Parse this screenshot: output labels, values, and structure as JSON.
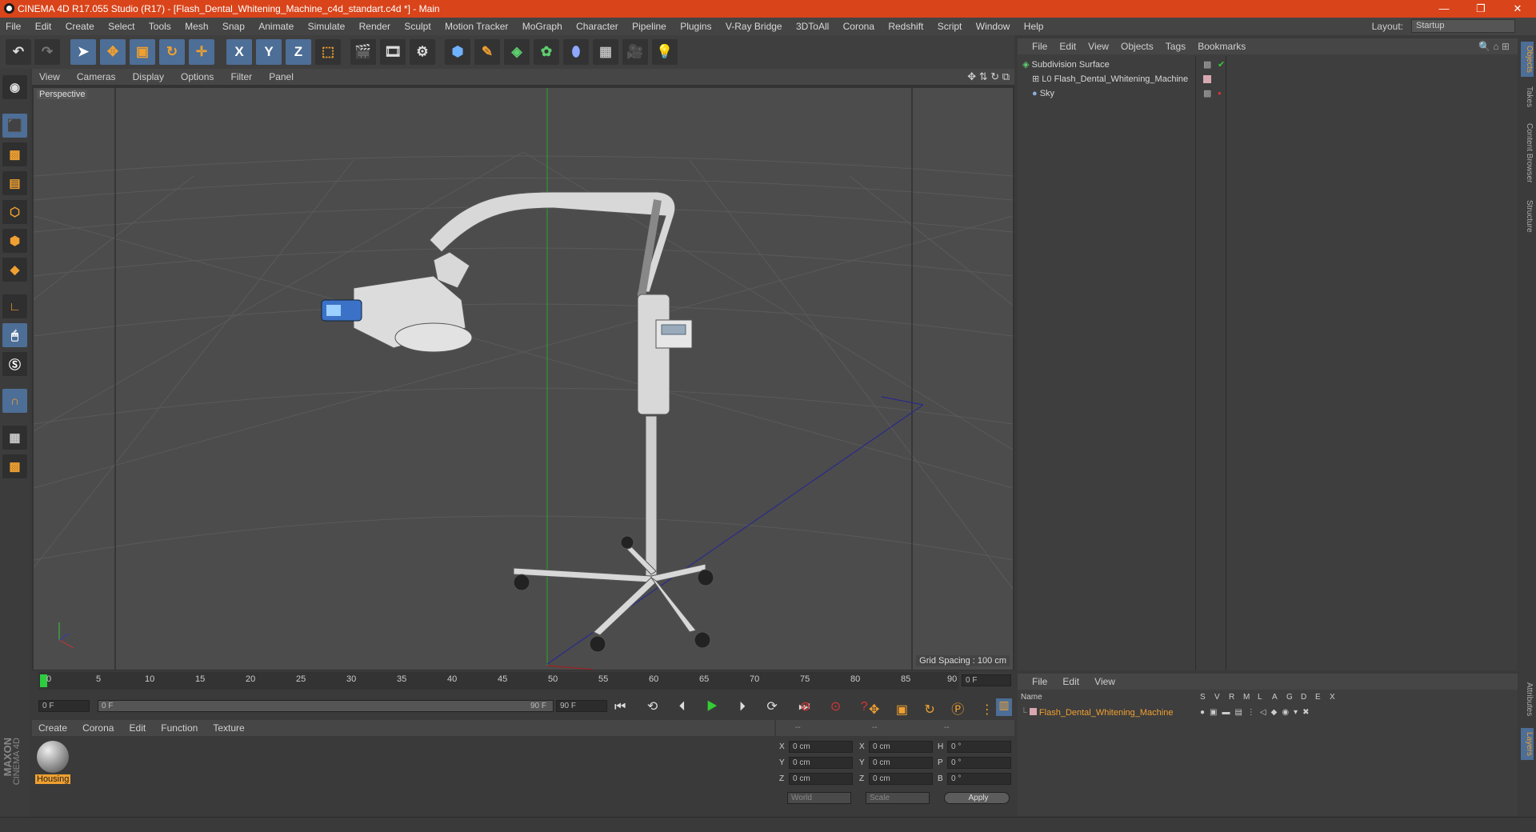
{
  "window": {
    "title": "CINEMA 4D R17.055 Studio (R17) - [Flash_Dental_Whitening_Machine_c4d_standart.c4d *] - Main",
    "controls": [
      "—",
      "❐",
      "✕"
    ]
  },
  "menu": [
    "File",
    "Edit",
    "Create",
    "Select",
    "Tools",
    "Mesh",
    "Snap",
    "Animate",
    "Simulate",
    "Render",
    "Sculpt",
    "Motion Tracker",
    "MoGraph",
    "Character",
    "Pipeline",
    "Plugins",
    "V-Ray Bridge",
    "3DToAll",
    "Corona",
    "Redshift",
    "Script",
    "Window",
    "Help"
  ],
  "layout": {
    "label": "Layout:",
    "value": "Startup"
  },
  "toolbar": {
    "x": "X",
    "y": "Y",
    "z": "Z"
  },
  "viewport": {
    "menu": [
      "View",
      "Cameras",
      "Display",
      "Options",
      "Filter",
      "Panel"
    ],
    "label": "Perspective",
    "grid_spacing": "Grid Spacing : 100 cm"
  },
  "timeline": {
    "ticks": [
      "0",
      "5",
      "10",
      "15",
      "20",
      "25",
      "30",
      "35",
      "40",
      "45",
      "50",
      "55",
      "60",
      "65",
      "70",
      "75",
      "80",
      "85",
      "90"
    ],
    "frame_end_field": "0 F",
    "start": "0 F",
    "range_start": "0 F",
    "range_end": "90 F",
    "end": "90 F"
  },
  "material_manager": {
    "menu": [
      "Create",
      "Corona",
      "Edit",
      "Function",
      "Texture"
    ],
    "material_name": "Housing"
  },
  "coords": {
    "headers": [
      "--",
      "--",
      "--"
    ],
    "rows": [
      {
        "a": "X",
        "av": "0 cm",
        "b": "X",
        "bv": "0 cm",
        "c": "H",
        "cv": "0 °"
      },
      {
        "a": "Y",
        "av": "0 cm",
        "b": "Y",
        "bv": "0 cm",
        "c": "P",
        "cv": "0 °"
      },
      {
        "a": "Z",
        "av": "0 cm",
        "b": "Z",
        "bv": "0 cm",
        "c": "B",
        "cv": "0 °"
      }
    ],
    "world": "World",
    "scale": "Scale",
    "apply": "Apply"
  },
  "objects": {
    "menu": [
      "File",
      "Edit",
      "View",
      "Objects",
      "Tags",
      "Bookmarks"
    ],
    "items": [
      "Subdivision Surface",
      "Flash_Dental_Whitening_Machine",
      "Sky"
    ]
  },
  "layers": {
    "menu": [
      "File",
      "Edit",
      "View"
    ],
    "name_header": "Name",
    "cols": [
      "S",
      "V",
      "R",
      "M",
      "L",
      "A",
      "G",
      "D",
      "E",
      "X"
    ],
    "item": "Flash_Dental_Whitening_Machine"
  },
  "right_tabs": [
    "Objects",
    "Takes",
    "Content Browser",
    "Structure",
    "Attributes",
    "Layers"
  ],
  "brand": {
    "maxon": "MAXON",
    "c4d": "CINEMA 4D"
  }
}
